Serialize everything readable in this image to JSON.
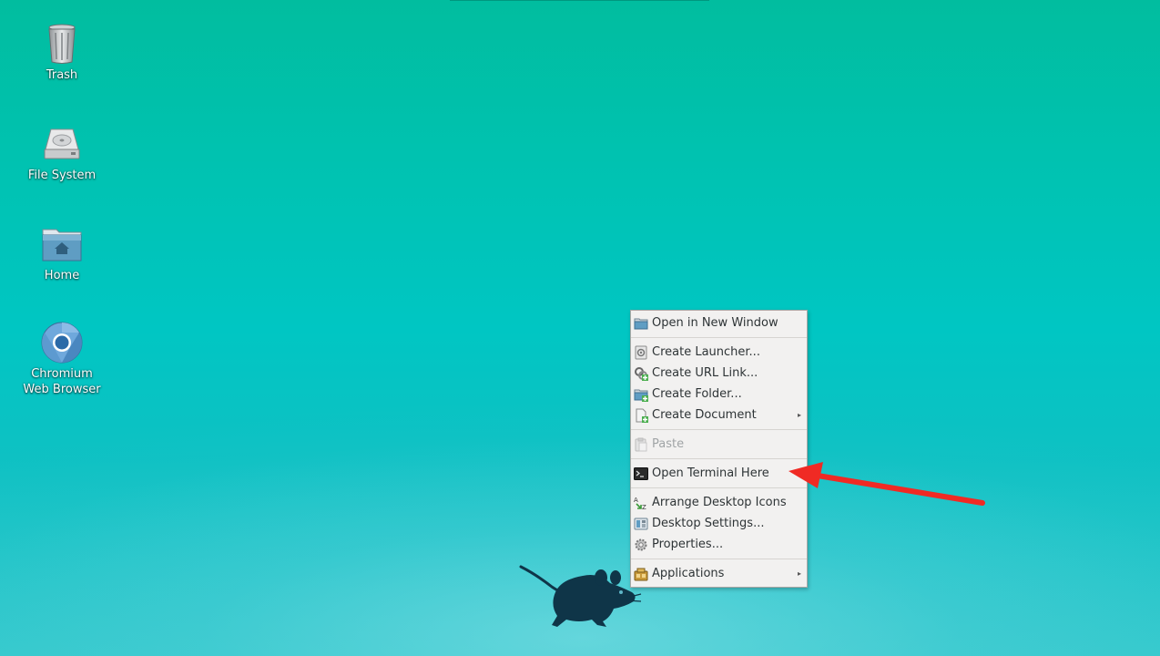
{
  "desktop": {
    "icons": [
      {
        "label": "Trash",
        "icon": "trash-icon"
      },
      {
        "label": "File System",
        "icon": "hard-drive-icon"
      },
      {
        "label": "Home",
        "icon": "home-folder-icon"
      },
      {
        "label": "Chromium\nWeb Browser",
        "icon": "chromium-icon"
      }
    ]
  },
  "context_menu": {
    "items": [
      {
        "label": "Open in New Window",
        "icon": "folder-icon",
        "enabled": true
      },
      {
        "label": "Create Launcher...",
        "icon": "launcher-icon",
        "enabled": true
      },
      {
        "label": "Create URL Link...",
        "icon": "link-icon",
        "enabled": true
      },
      {
        "label": "Create Folder...",
        "icon": "new-folder-icon",
        "enabled": true
      },
      {
        "label": "Create Document",
        "icon": "new-document-icon",
        "enabled": true,
        "submenu": true
      },
      {
        "label": "Paste",
        "icon": "paste-icon",
        "enabled": false
      },
      {
        "label": "Open Terminal Here",
        "icon": "terminal-icon",
        "enabled": true
      },
      {
        "label": "Arrange Desktop Icons",
        "icon": "sort-icon",
        "enabled": true
      },
      {
        "label": "Desktop Settings...",
        "icon": "desktop-settings-icon",
        "enabled": true
      },
      {
        "label": "Properties...",
        "icon": "gear-icon",
        "enabled": true
      },
      {
        "label": "Applications",
        "icon": "applications-icon",
        "enabled": true,
        "submenu": true
      }
    ],
    "submenu_arrow": "▸"
  },
  "annotation": {
    "color": "#f02a24",
    "points_to": "Open Terminal Here"
  },
  "colors": {
    "desktop_top": "#01bd9f",
    "desktop_bottom": "#33c9cc",
    "menu_bg": "#f2f1f0",
    "mascot": "#0f3548"
  }
}
